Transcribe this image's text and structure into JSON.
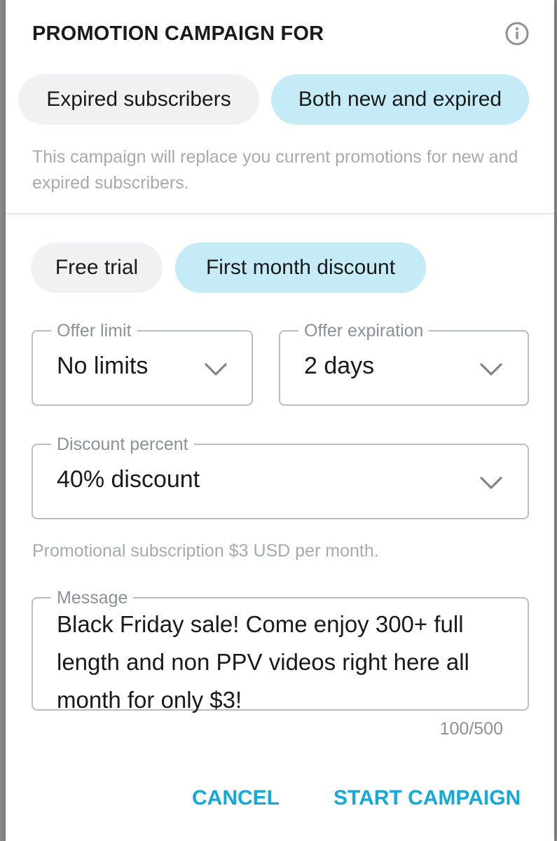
{
  "dialog": {
    "title": "PROMOTION CAMPAIGN FOR",
    "info_icon": "info-circle-icon"
  },
  "audience": {
    "options": [
      {
        "label": "Expired subscribers",
        "selected": false
      },
      {
        "label": "Both new and expired",
        "selected": true
      }
    ],
    "hint": "This campaign will replace you current promotions for new and expired subscribers."
  },
  "offer_type": {
    "options": [
      {
        "label": "Free trial",
        "selected": false
      },
      {
        "label": "First month discount",
        "selected": true
      }
    ]
  },
  "offer_limit": {
    "label": "Offer limit",
    "value": "No limits",
    "icon": "chevron-down-icon"
  },
  "offer_expiration": {
    "label": "Offer expiration",
    "value": "2 days",
    "icon": "chevron-down-icon"
  },
  "discount_percent": {
    "label": "Discount percent",
    "value": "40% discount",
    "icon": "chevron-down-icon"
  },
  "price_hint": "Promotional subscription $3 USD per month.",
  "message": {
    "label": "Message",
    "value": "Black Friday sale! Come enjoy 300+ full length and non PPV videos right here all month for only $3!",
    "counter": "100/500"
  },
  "actions": {
    "cancel": "CANCEL",
    "start": "START CAMPAIGN"
  },
  "colors": {
    "accent": "#14a9d8",
    "selected_pill": "#c5ebf7",
    "unselected_pill": "#f0f1f2",
    "hint_text": "#a4abb1",
    "field_border": "#b8bec3"
  }
}
